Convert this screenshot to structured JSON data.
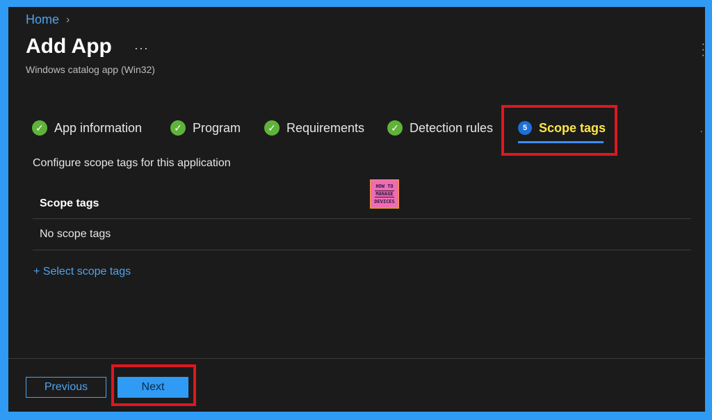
{
  "breadcrumb": {
    "home": "Home",
    "separator": "›"
  },
  "header": {
    "title": "Add App",
    "more": "···",
    "subtitle": "Windows catalog app (Win32)"
  },
  "steps": [
    {
      "label": "App information",
      "status": "completed",
      "icon": "check-icon"
    },
    {
      "label": "Program",
      "status": "completed",
      "icon": "check-icon"
    },
    {
      "label": "Requirements",
      "status": "completed",
      "icon": "check-icon"
    },
    {
      "label": "Detection rules",
      "status": "completed",
      "icon": "check-icon"
    },
    {
      "label": "Scope tags",
      "status": "active",
      "number": "5"
    }
  ],
  "content": {
    "description": "Configure scope tags for this application",
    "table": {
      "header": "Scope tags",
      "rows": [
        "No scope tags"
      ]
    },
    "select_link": "+ Select scope tags"
  },
  "logo": {
    "line1": "HOW TO",
    "line2": "MANAGE",
    "line3": "DEVICES"
  },
  "footer": {
    "previous_label": "Previous",
    "next_label": "Next"
  },
  "colors": {
    "accent": "#2f9bf5",
    "active_step_text": "#ffe54a",
    "completed": "#5fb33a",
    "highlight": "#e0161e",
    "background": "#1b1b1b"
  }
}
